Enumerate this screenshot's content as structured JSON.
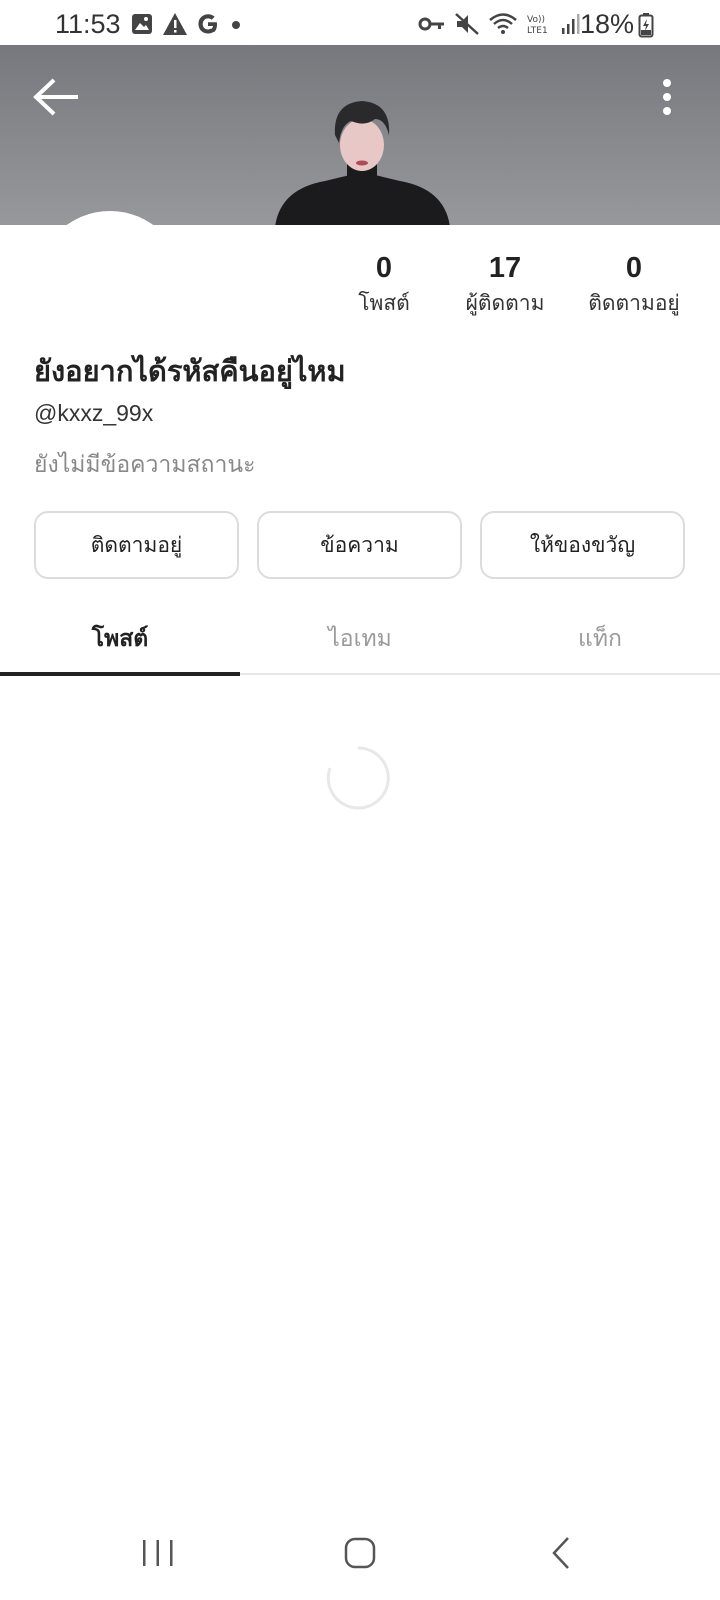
{
  "status_bar": {
    "time": "11:53",
    "battery": "18%",
    "icons_left": [
      "image-icon",
      "warning-icon",
      "google-icon",
      "dot-icon"
    ],
    "icons_right": [
      "key-icon",
      "mute-icon",
      "wifi-icon",
      "volte-icon",
      "signal-icon",
      "battery-icon"
    ]
  },
  "profile": {
    "stats": [
      {
        "value": "0",
        "label": "โพสต์"
      },
      {
        "value": "17",
        "label": "ผู้ติดตาม"
      },
      {
        "value": "0",
        "label": "ติดตามอยู่"
      }
    ],
    "name": "ยังอยากได้รหัสคืนอยู่ไหม",
    "handle": "@kxxz_99x",
    "status_text": "ยังไม่มีข้อความสถานะ"
  },
  "actions": {
    "following": "ติดตามอยู่",
    "message": "ข้อความ",
    "gift": "ให้ของขวัญ"
  },
  "tabs": [
    {
      "label": "โพสต์",
      "active": true
    },
    {
      "label": "ไอเทม",
      "active": false
    },
    {
      "label": "แท็ก",
      "active": false
    }
  ],
  "colors": {
    "cover_top": "#77787d",
    "cover_bottom": "#97989c",
    "active_tab": "#222222",
    "inactive_tab": "#9a9a9a"
  }
}
